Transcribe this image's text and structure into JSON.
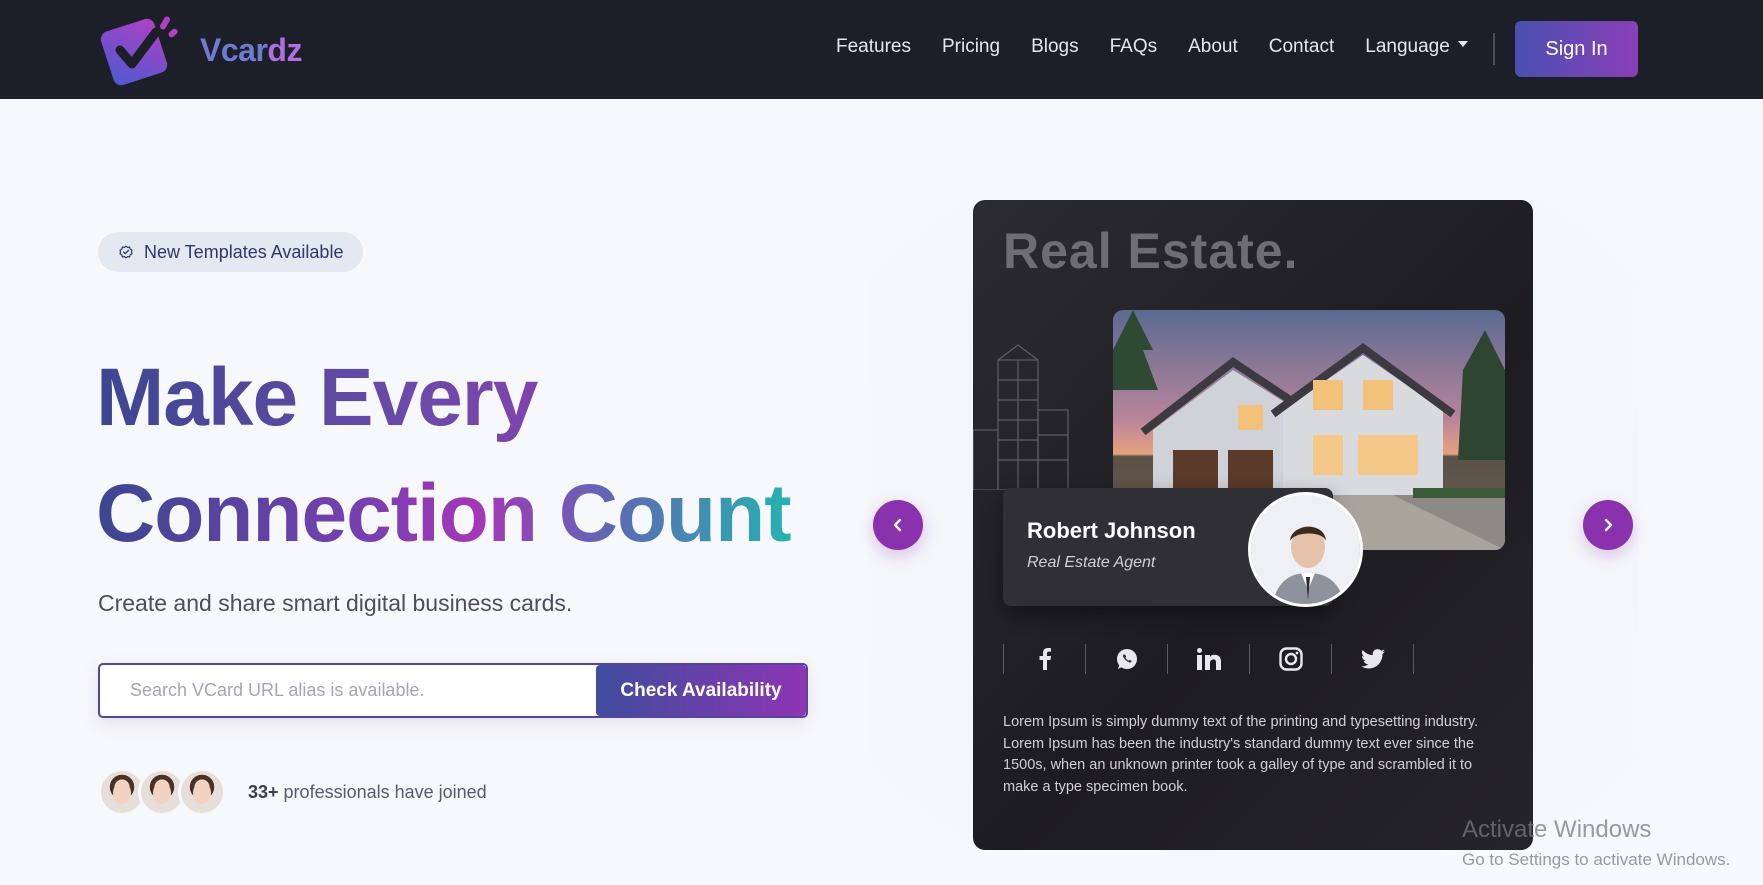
{
  "brand": {
    "name_part1": "Vcar",
    "name_part2": "dz"
  },
  "nav": {
    "links": [
      "Features",
      "Pricing",
      "Blogs",
      "FAQs",
      "About",
      "Contact"
    ],
    "language_label": "Language",
    "signin_label": "Sign In"
  },
  "hero": {
    "badge_label": "New Templates Available",
    "headline": {
      "line1_a": "Make ",
      "line1_b": "Every",
      "line2_a": "Connection ",
      "line2_b": "Count"
    },
    "subtitle": "Create and share smart digital business cards.",
    "search": {
      "placeholder": "Search VCard URL alias is available.",
      "value": "",
      "button_label": "Check Availability"
    },
    "joined": {
      "count": "33+",
      "text": " professionals have joined"
    }
  },
  "card": {
    "title": "Real Estate.",
    "name": "Robert Johnson",
    "role": "Real Estate Agent",
    "socials": [
      "facebook-icon",
      "whatsapp-icon",
      "linkedin-icon",
      "instagram-icon",
      "twitter-icon"
    ],
    "description": "Lorem Ipsum is simply dummy text of the printing and typesetting industry. Lorem Ipsum has been the industry's standard dummy text ever since the 1500s, when an unknown printer took a galley of type and scrambled it to make a type specimen book."
  },
  "watermark": {
    "title": "Activate Windows",
    "subtitle": "Go to Settings to activate Windows."
  },
  "colors": {
    "navbar_bg": "#1c1f27",
    "accent_purple": "#8a31ad",
    "accent_indigo": "#3f4c9c",
    "accent_teal": "#25b3b0",
    "page_bg": "#f7f8fb"
  }
}
